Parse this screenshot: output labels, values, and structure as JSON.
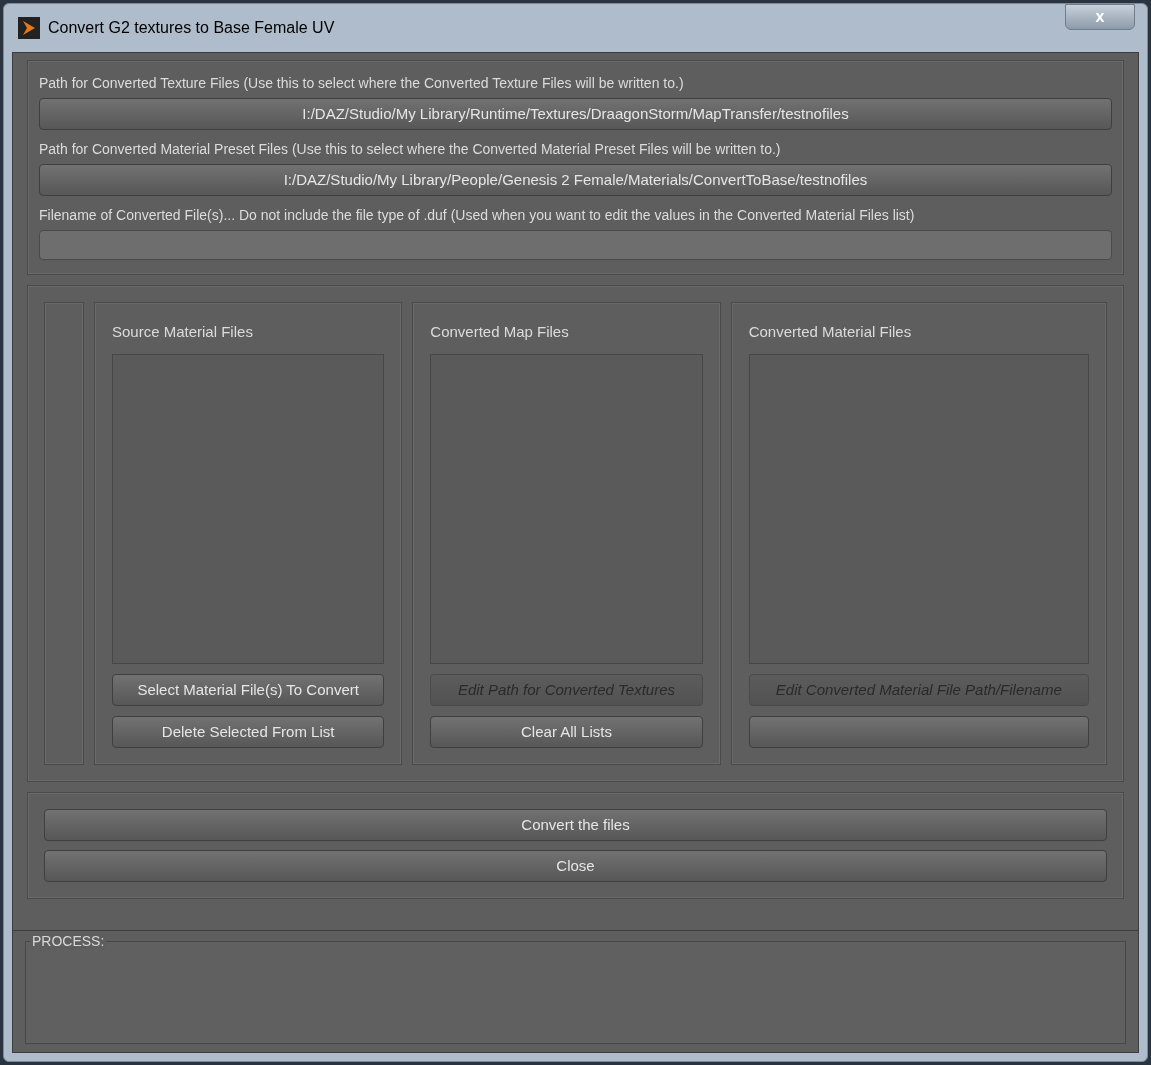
{
  "window": {
    "title": "Convert G2 textures to Base Female UV",
    "close_label": "x"
  },
  "paths": [
    {
      "label": "Path for Converted Texture Files (Use this to select where the Converted Texture Files will be written to.)",
      "kind": "button",
      "value": "I:/DAZ/Studio/My Library/Runtime/Textures/DraagonStorm/MapTransfer/testnofiles"
    },
    {
      "label": "Path for Converted Material Preset Files (Use this to select where the Converted Material Preset Files will be written to.)",
      "kind": "button",
      "value": "I:/DAZ/Studio/My Library/People/Genesis 2 Female/Materials/ConvertToBase/testnofiles"
    },
    {
      "label": "Filename of Converted File(s)... Do not include the file type of .duf (Used when you want to edit the values in the Converted Material Files list)",
      "kind": "field"
    }
  ],
  "columns": [
    {
      "title": "Source Material Files",
      "buttons": [
        {
          "label": "Select Material File(s) To Convert",
          "disabled": false
        },
        {
          "label": "Delete Selected From List",
          "disabled": false
        }
      ]
    },
    {
      "title": "Converted Map Files",
      "buttons": [
        {
          "label": "Edit Path for Converted Textures",
          "disabled": true
        },
        {
          "label": "Clear All Lists",
          "disabled": false
        }
      ]
    },
    {
      "title": "Converted Material Files",
      "buttons": [
        {
          "label": "Edit Converted Material File Path/Filename",
          "disabled": true
        },
        {
          "disabled": false
        }
      ]
    }
  ],
  "actions": [
    {
      "label": "Convert the files"
    },
    {
      "label": "Close"
    }
  ],
  "process": {
    "label": "PROCESS:"
  }
}
